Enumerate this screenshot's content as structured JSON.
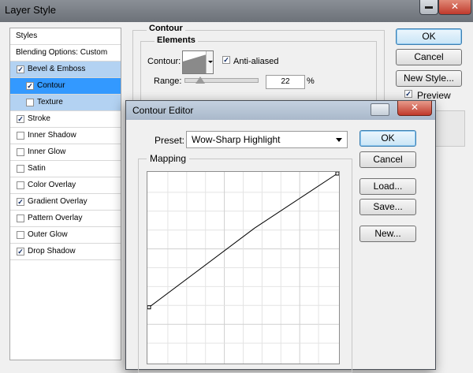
{
  "layer_style": {
    "title": "Layer Style",
    "close_glyph": "✕",
    "styles_list": [
      {
        "label": "Styles",
        "checkbox": false,
        "checked": false,
        "selected": "none"
      },
      {
        "label": "Blending Options: Custom",
        "checkbox": false,
        "checked": false,
        "selected": "none"
      },
      {
        "label": "Bevel & Emboss",
        "checkbox": true,
        "checked": true,
        "selected": "light"
      },
      {
        "label": "Contour",
        "checkbox": true,
        "checked": true,
        "selected": "dark",
        "sub": true
      },
      {
        "label": "Texture",
        "checkbox": true,
        "checked": false,
        "selected": "light",
        "sub": true
      },
      {
        "label": "Stroke",
        "checkbox": true,
        "checked": true,
        "selected": "none"
      },
      {
        "label": "Inner Shadow",
        "checkbox": true,
        "checked": false,
        "selected": "none"
      },
      {
        "label": "Inner Glow",
        "checkbox": true,
        "checked": false,
        "selected": "none"
      },
      {
        "label": "Satin",
        "checkbox": true,
        "checked": false,
        "selected": "none"
      },
      {
        "label": "Color Overlay",
        "checkbox": true,
        "checked": false,
        "selected": "none"
      },
      {
        "label": "Gradient Overlay",
        "checkbox": true,
        "checked": true,
        "selected": "none"
      },
      {
        "label": "Pattern Overlay",
        "checkbox": true,
        "checked": false,
        "selected": "none"
      },
      {
        "label": "Outer Glow",
        "checkbox": true,
        "checked": false,
        "selected": "none"
      },
      {
        "label": "Drop Shadow",
        "checkbox": true,
        "checked": true,
        "selected": "none"
      }
    ],
    "contour_section": {
      "title": "Contour",
      "elements_title": "Elements",
      "contour_label": "Contour:",
      "anti_aliased_label": "Anti-aliased",
      "anti_aliased_checked": true,
      "range_label": "Range:",
      "range_value": "22",
      "range_unit": "%",
      "range_fraction": 0.22
    },
    "buttons": {
      "ok": "OK",
      "cancel": "Cancel",
      "new_style": "New Style..."
    },
    "preview_label": "Preview",
    "preview_checked": true
  },
  "contour_editor": {
    "title": "Contour Editor",
    "close_glyph": "✕",
    "preset_label": "Preset:",
    "preset_value": "Wow-Sharp Highlight",
    "mapping_label": "Mapping",
    "buttons": {
      "ok": "OK",
      "cancel": "Cancel",
      "load": "Load...",
      "save": "Save...",
      "new": "New..."
    },
    "curve_points": [
      {
        "input": 0,
        "output": 0.29
      },
      {
        "input": 0.56,
        "output": 0.71
      },
      {
        "input": 1,
        "output": 1
      }
    ],
    "grid_divisions": 10
  },
  "colors": {
    "selection_light": "#b3d2f2",
    "selection_dark": "#3399ff",
    "close_red": "#c0392b"
  }
}
